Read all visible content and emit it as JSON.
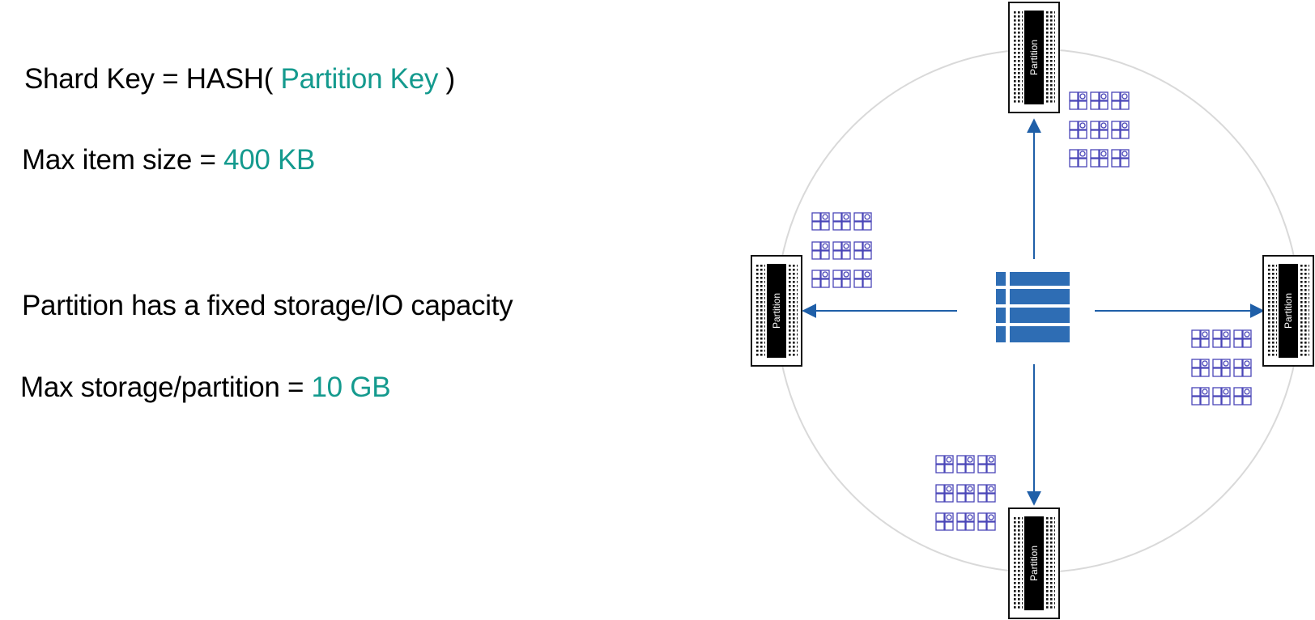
{
  "lines": {
    "shard_key": {
      "prefix": "Shard Key = HASH( ",
      "value": "Partition Key",
      "suffix": " )"
    },
    "max_item": {
      "prefix": "Max item size = ",
      "value": "400 KB"
    },
    "partition_capacity": {
      "text": "Partition has a fixed storage/IO capacity"
    },
    "max_storage": {
      "prefix": "Max storage/partition = ",
      "value": "10 GB"
    }
  },
  "diagram": {
    "partition_label": "Partition",
    "colors": {
      "accent_text": "#149a8e",
      "arrow": "#1f5fa8",
      "table_icon": "#2e6db4",
      "item_icon": "#4a46b8",
      "ring": "#d9d9d9"
    },
    "icons": [
      "table-icon",
      "partition-icon",
      "item-group-icon",
      "arrow-icon"
    ]
  }
}
